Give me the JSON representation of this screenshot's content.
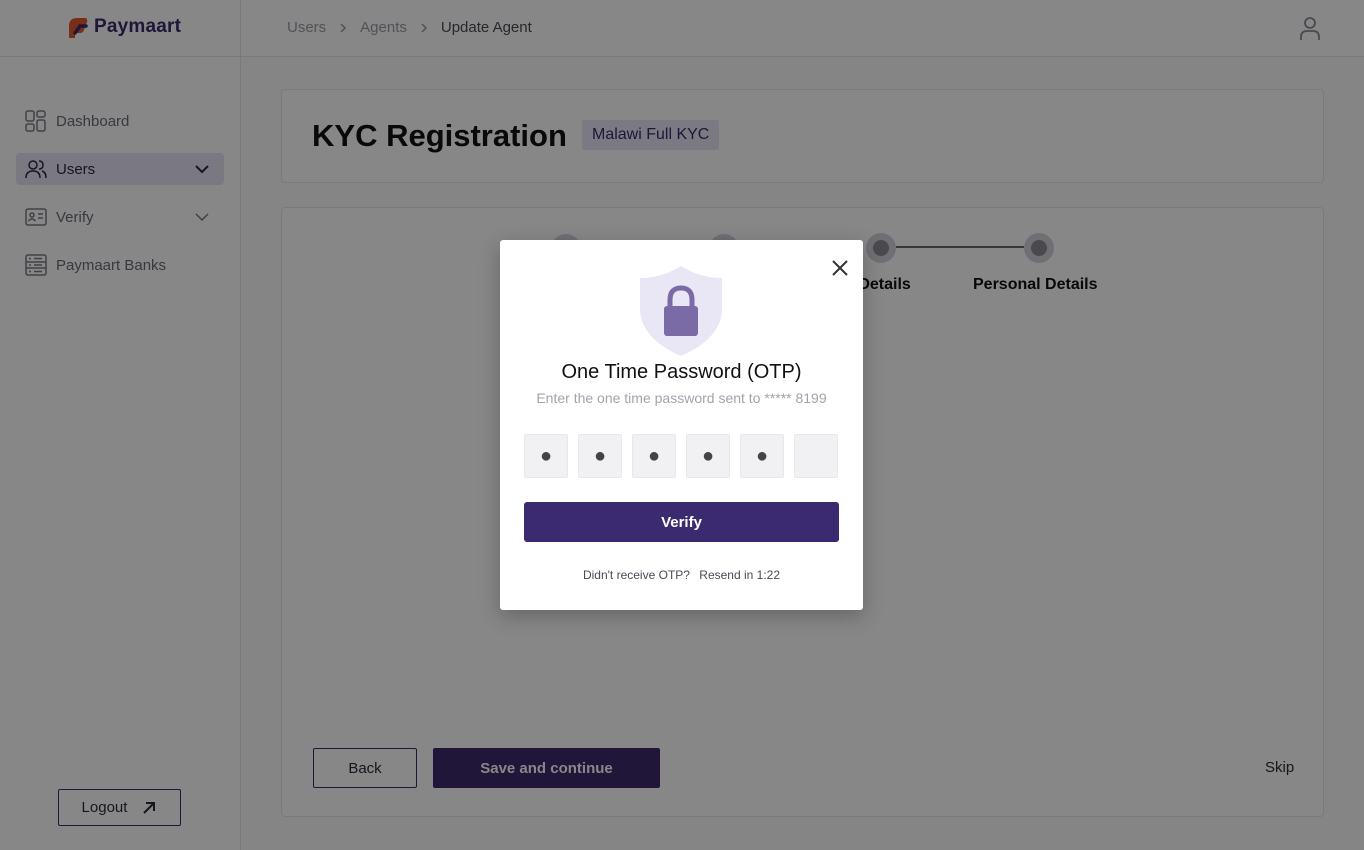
{
  "app": {
    "logo_text": "Paymaart",
    "brand_color": "#3b2a6f"
  },
  "breadcrumb": {
    "items": [
      "Users",
      "Agents",
      "Update Agent"
    ]
  },
  "sidebar": {
    "items": [
      {
        "label": "Dashboard",
        "icon": "dashboard-icon",
        "active": false
      },
      {
        "label": "Users",
        "icon": "users-icon",
        "active": true
      },
      {
        "label": "Verify",
        "icon": "id-card-icon",
        "active": false
      },
      {
        "label": "Paymaart Banks",
        "icon": "bank-list-icon",
        "active": false
      }
    ],
    "logout_label": "Logout"
  },
  "page": {
    "title": "KYC Registration",
    "badge": "Malawi Full KYC"
  },
  "stepper": {
    "visible_labels": [
      "y Details",
      "Personal Details"
    ]
  },
  "form_actions": {
    "back_label": "Back",
    "save_label": "Save and continue",
    "skip_label": "Skip"
  },
  "otp_modal": {
    "title": "One Time Password (OTP)",
    "subtitle": "Enter the one time password sent to ***** 8199",
    "digits": [
      "●",
      "●",
      "●",
      "●",
      "●",
      ""
    ],
    "verify_label": "Verify",
    "resend_prompt": "Didn't receive OTP?",
    "resend_timer": "Resend in 1:22"
  }
}
